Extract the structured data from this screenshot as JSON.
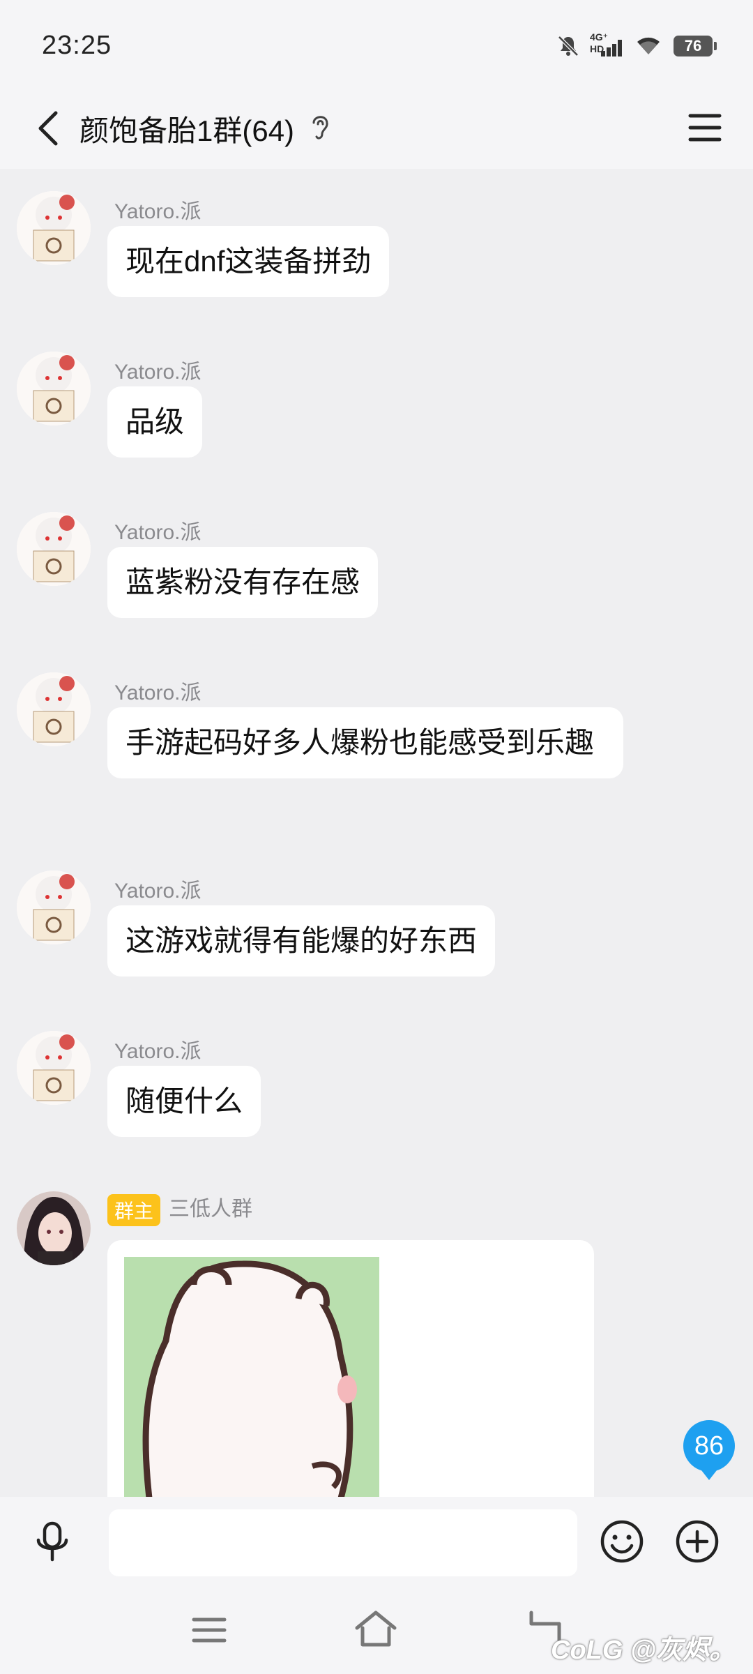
{
  "status_bar": {
    "time": "23:25",
    "network": "4G⁺ HD",
    "battery": "76"
  },
  "header": {
    "title": "颜饱备胎1群(64)",
    "back_icon": "chevron-left-icon",
    "menu_icon": "hamburger-menu-icon",
    "ear_icon": "ear-icon"
  },
  "messages": [
    {
      "sender": "Yatoro.派",
      "text": "现在dnf这装备拼劲"
    },
    {
      "sender": "Yatoro.派",
      "text": "品级"
    },
    {
      "sender": "Yatoro.派",
      "text": "蓝紫粉没有存在感"
    },
    {
      "sender": "Yatoro.派",
      "text": "手游起码好多人爆粉也能感受到乐趣"
    },
    {
      "sender": "Yatoro.派",
      "text": "这游戏就得有能爆的好东西"
    },
    {
      "sender": "Yatoro.派",
      "text": "随便什么"
    },
    {
      "sender": "三低人群",
      "role_badge": "群主",
      "text": "",
      "type": "image"
    }
  ],
  "unread_count": "86",
  "input": {
    "placeholder": ""
  },
  "watermark": "CoLG @灰烬。",
  "colors": {
    "background": "#efeff1",
    "bubble": "#ffffff",
    "owner_badge": "#fcc21b",
    "unread": "#1ea0f0"
  }
}
